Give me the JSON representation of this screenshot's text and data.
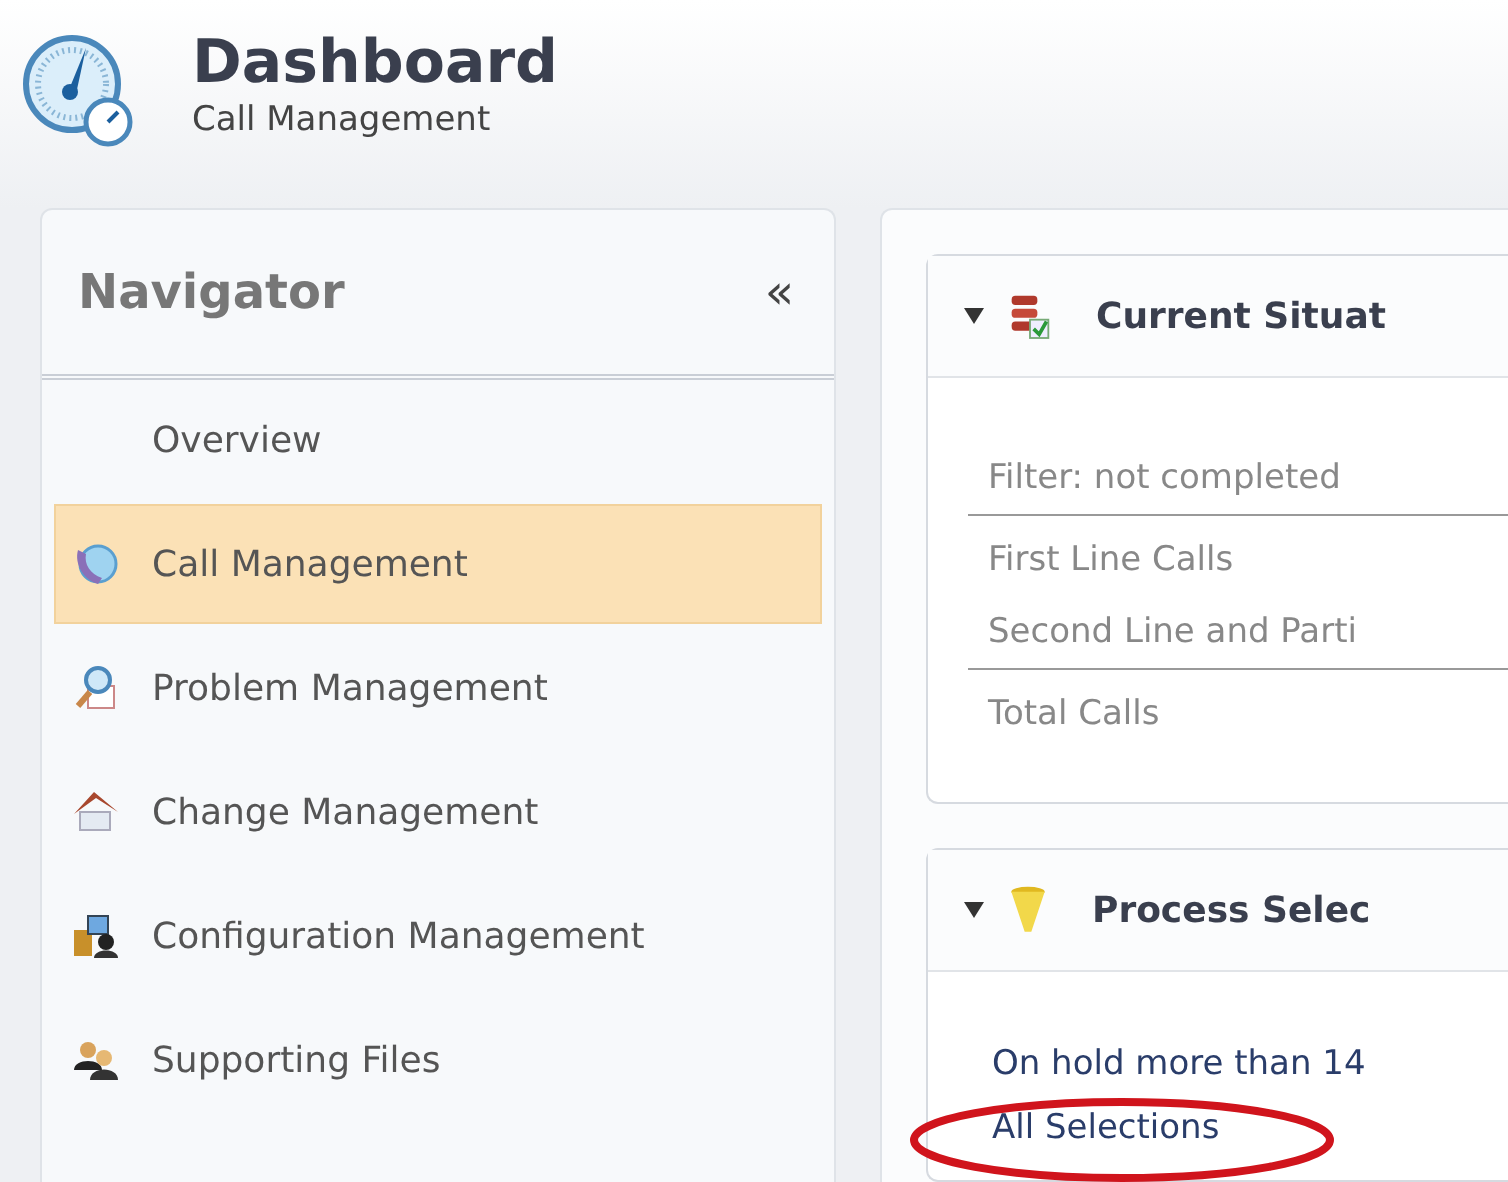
{
  "header": {
    "title": "Dashboard",
    "subtitle": "Call Management"
  },
  "navigator": {
    "title": "Navigator",
    "collapse": "«",
    "items": [
      {
        "label": "Overview",
        "kind": "none",
        "selected": false
      },
      {
        "label": "Call Management",
        "kind": "phone",
        "selected": true
      },
      {
        "label": "Problem Management",
        "kind": "magnifier",
        "selected": false
      },
      {
        "label": "Change Management",
        "kind": "house",
        "selected": false
      },
      {
        "label": "Configuration Management",
        "kind": "config",
        "selected": false
      },
      {
        "label": "Supporting Files",
        "kind": "people",
        "selected": false
      }
    ]
  },
  "panels": [
    {
      "title": "Current Situat",
      "kind": "situation",
      "expanded": true,
      "rows": [
        {
          "label": "Filter: not completed",
          "underlined": true
        },
        {
          "label": "First Line Calls",
          "underlined": false
        },
        {
          "label": "Second Line and Parti",
          "underlined": true
        },
        {
          "label": "Total Calls",
          "underlined": false
        }
      ]
    },
    {
      "title": "Process Selec",
      "kind": "funnel",
      "expanded": true,
      "rows": [
        {
          "label": "On hold more than 14",
          "underlined": false,
          "circled": false
        },
        {
          "label": "All Selections",
          "underlined": false,
          "circled": true
        }
      ]
    }
  ]
}
